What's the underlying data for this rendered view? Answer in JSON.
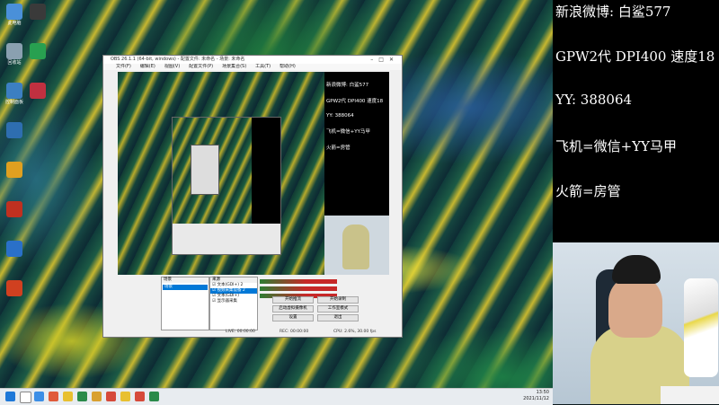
{
  "desktop_icons": [
    {
      "label": "此电脑",
      "color": "#4a90d9"
    },
    {
      "label": "回收站",
      "color": "#8aa0b0"
    },
    {
      "label": "控制面板",
      "color": "#3c7fc2"
    },
    {
      "label": "",
      "color": "#2e6eb0"
    },
    {
      "label": "",
      "color": "#e0a020"
    },
    {
      "label": "",
      "color": "#c03020"
    },
    {
      "label": "",
      "color": "#2a70c8"
    },
    {
      "label": "",
      "color": "#d04020"
    },
    {
      "label": "",
      "color": "#3a3a3a"
    },
    {
      "label": "",
      "color": "#28a050"
    },
    {
      "label": "",
      "color": "#c03040"
    }
  ],
  "obs": {
    "title": "OBS 26.1.1 (64-bit, windows) - 配置文件: 未命名 - 场景: 未命名",
    "menu": [
      "文件(F)",
      "编辑(E)",
      "视图(V)",
      "配置文件(P)",
      "场景集合(S)",
      "工具(T)",
      "帮助(H)"
    ],
    "preview_lines": [
      "新浪微博: 白鲨577",
      "GPW2代 DPI400 速度18",
      "YY: 388064",
      "飞机=微信+YY马甲",
      "火箭=房管"
    ],
    "scenes_header": "场景",
    "scenes": [
      "场景"
    ],
    "sources_header": "来源",
    "sources": [
      {
        "label": "文本(GDI+) 2",
        "selected": false
      },
      {
        "label": "视频采集设备 2",
        "selected": true
      },
      {
        "label": "文本(GDI+)",
        "selected": false
      },
      {
        "label": "显示器采集",
        "selected": false
      }
    ],
    "controls": [
      "开始推流",
      "开始录制",
      "启动虚拟摄像机",
      "工作室模式",
      "设置",
      "退出"
    ],
    "status": {
      "live": "LIVE: 00:00:00",
      "rec": "REC: 00:00:00",
      "cpu": "CPU: 2.6%, 30.00 fps"
    }
  },
  "overlay": {
    "lines": [
      "新浪微博: 白鲨577",
      "GPW2代 DPI400 速度18",
      "YY: 388064",
      "飞机=微信+YY马甲",
      "火箭=房管"
    ]
  },
  "taskbar": {
    "icon_colors": [
      "#1e78d8",
      "#ffffff",
      "#3b8ee6",
      "#e05a3a",
      "#e8c030",
      "#2a8a4a",
      "#d9a030",
      "#d64a3a",
      "#e8c030",
      "#d64a3a",
      "#2a8a4a"
    ],
    "time": "13:50",
    "date": "2021/11/12"
  }
}
